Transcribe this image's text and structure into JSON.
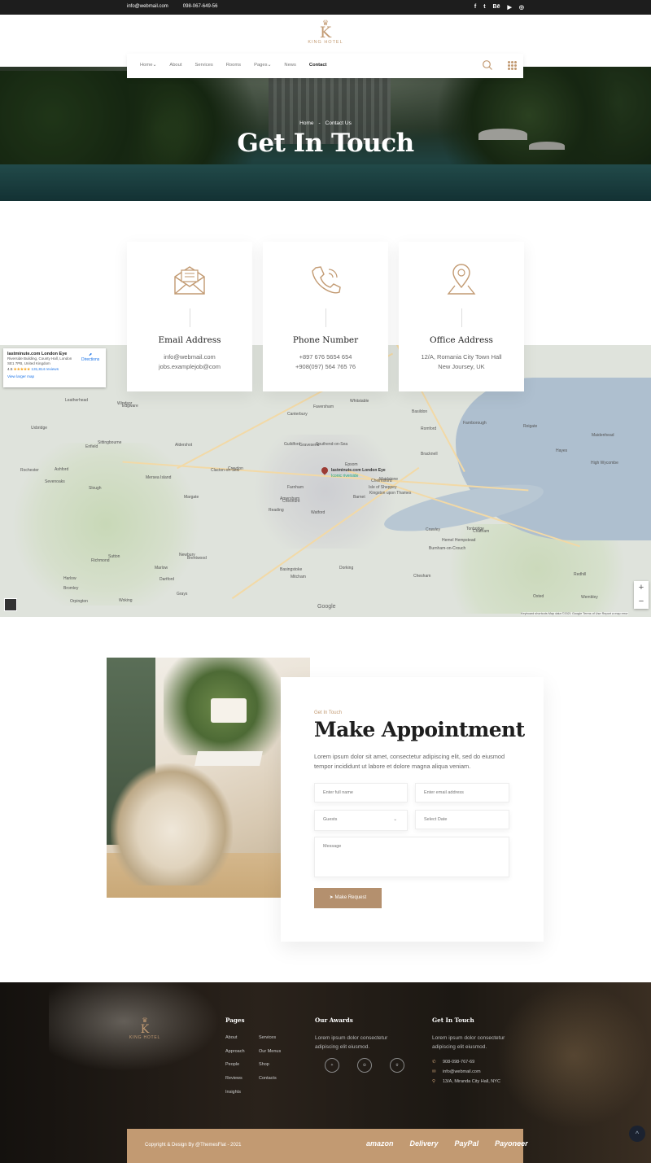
{
  "topbar": {
    "email": "info@webmail.com",
    "phone": "098-067-649-56",
    "social": [
      "f",
      "t",
      "Bē",
      "▶",
      "◎"
    ]
  },
  "brand": {
    "initial": "K",
    "name": "KING HOTEL",
    "crown": "♛"
  },
  "nav": {
    "items": [
      "Home⌄",
      "About",
      "Services",
      "Rooms",
      "Pages⌄",
      "News",
      "Contact"
    ],
    "active": "Contact"
  },
  "hero": {
    "breadcrumb": [
      "Home",
      "-",
      "Contact Us"
    ],
    "title": "Get In Touch"
  },
  "contact_cards": [
    {
      "title": "Email Address",
      "line1": "info@webmail.com",
      "line2": "jobs.examplejob@com",
      "icon": "envelope-icon"
    },
    {
      "title": "Phone Number",
      "line1": "+897 676 5654 654",
      "line2": "+908(097) 564 765 76",
      "icon": "phone-icon"
    },
    {
      "title": "Office Address",
      "line1": "12/A, Romania City Town Hall",
      "line2": "New Joursey, UK",
      "icon": "location-pin-icon"
    }
  ],
  "map": {
    "place_title": "lastminute.com London Eye",
    "place_address": "Riverside Building, County Hall, London SE1 7PB, United Kingdom",
    "rating": "4.5",
    "stars": "★★★★★",
    "reviews": "131,814 reviews",
    "larger_map": "View larger map",
    "directions": "Directions",
    "pin_label": "lastminute.com London Eye",
    "pin_sub": "Iconic riverside",
    "labels": [
      "Watford",
      "Enfield",
      "Cheshunt",
      "Harlow",
      "Chelmsford",
      "Brentwood",
      "Basildon",
      "Southend-on-Sea",
      "Romford",
      "Barnet",
      "Edgware",
      "Wembley",
      "Slough",
      "Maidenhead",
      "Reading",
      "Bracknell",
      "Woking",
      "Guildford",
      "Epsom",
      "Sutton",
      "Croydon",
      "Bromley",
      "Dartford",
      "Gravesend",
      "Maidstone",
      "Chatham",
      "Sittingbourne",
      "Canterbury",
      "Sevenoaks",
      "Crawley",
      "High Wycombe",
      "Amersham",
      "Basingstoke",
      "Farnham",
      "Aldershot",
      "Farnborough",
      "Newbury",
      "Oxted",
      "Redhill",
      "Tonbridge",
      "Whitstable",
      "Clacton-on-Sea",
      "Mersea Island",
      "Burnham-on-Crouch",
      "Grays",
      "Rochester",
      "Isle of Sheppey",
      "Orpington",
      "Mitcham",
      "Kingston upon Thames",
      "Richmond",
      "Hayes",
      "Uxbridge",
      "Hemel Hempstead",
      "Chesham",
      "Marlow",
      "Windsor",
      "Leatherhead",
      "Dorking",
      "Reigate",
      "Faversham",
      "Margate",
      "Ashford"
    ],
    "zoom_in": "+",
    "zoom_out": "−",
    "footer": "Keyboard shortcuts   Map data ©2021 Google   Terms of Use   Report a map error",
    "google": "Google"
  },
  "appointment": {
    "subtitle": "Get In Touch",
    "title": "Make Appointment",
    "description": "Lorem ipsum dolor sit amet, consectetur adipiscing elit, sed do eiusmod tempor incididunt ut labore et dolore magna aliqua veniam.",
    "name_placeholder": "Enter full name",
    "email_placeholder": "Enter email address",
    "guests_value": "Guests",
    "date_placeholder": "Select Date",
    "message_placeholder": "Message",
    "button": "Make Request",
    "button_icon": "➤"
  },
  "footer": {
    "pages_title": "Pages",
    "pages_col1": [
      "About",
      "Approach",
      "People",
      "Reviews",
      "Insights"
    ],
    "pages_col2": [
      "Services",
      "Our Menus",
      "Shop",
      "Contacts"
    ],
    "awards_title": "Our Awards",
    "awards_text": "Lorem ipsum dolor  consectetur adipiscing elit eiusmod.",
    "contact_title": "Get In Touch",
    "contact_text": "Lorem ipsum dolor  consectetur adipiscing elit eiusmod.",
    "phone": "908-098-767-69",
    "email": "info@webmail.com",
    "address": "13/A, Miranda City Hall, NYC",
    "copyright": "Copyright & Design By @ThemesFlat - 2021",
    "payment_logos": [
      "amazon",
      "Delivery",
      "PayPal",
      "Payoneer"
    ],
    "to_top": "^"
  },
  "colors": {
    "accent": "#c29a72",
    "button": "#b4906e",
    "dark": "#1d1d1d"
  }
}
